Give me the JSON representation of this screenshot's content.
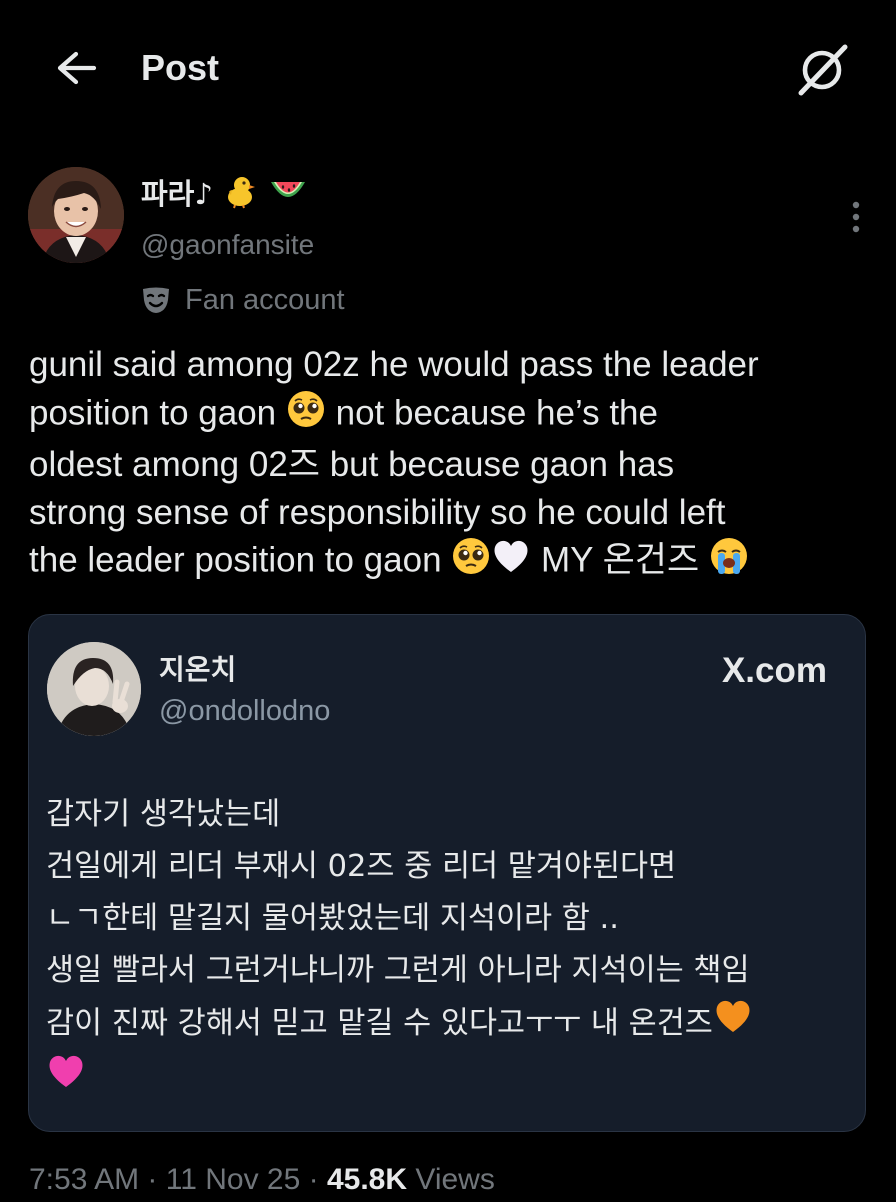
{
  "header": {
    "title": "Post",
    "back_icon": "arrow-left-icon",
    "grok_icon": "grok-icon"
  },
  "author": {
    "display_name": "파라♪",
    "display_emojis": [
      "chick-emoji",
      "watermelon-emoji"
    ],
    "handle": "@gaonfansite",
    "label": "Fan account",
    "label_icon": "mask-icon",
    "more_icon": "more-vertical-icon"
  },
  "tweet": {
    "lines": [
      "gunil said among 02z he would pass the leader",
      "position to gaon",
      "not because he’s the",
      "oldest among 02즈 but because gaon has",
      "strong sense of responsibility so he could left",
      "the leader position to gaon",
      "MY 온건즈"
    ]
  },
  "quote": {
    "display_name": "지온치",
    "handle": "@ondollodno",
    "source": "X.com",
    "lines": [
      "갑자기 생각났는데",
      "건일에게 리더 부재시 02즈 중 리더 맡겨야된다면",
      "ㄴㄱ한테 맡길지 물어봤었는데 지석이라 함 ..",
      "생일 빨라서 그런거냐니까 그런게 아니라 지석이는 책임",
      "감이 진짜 강해서 믿고 맡길 수 있다고ㅜㅜ 내 온건즈"
    ]
  },
  "meta": {
    "time": "7:53 AM",
    "sep1": " · ",
    "date": "11 Nov 25",
    "sep2": " · ",
    "views_count": "45.8K",
    "views_label": " Views"
  },
  "colors": {
    "background": "#000000",
    "text": "#e7e9ea",
    "secondary": "#71767b",
    "card_background": "#151d2a",
    "card_border": "#2a3444"
  }
}
